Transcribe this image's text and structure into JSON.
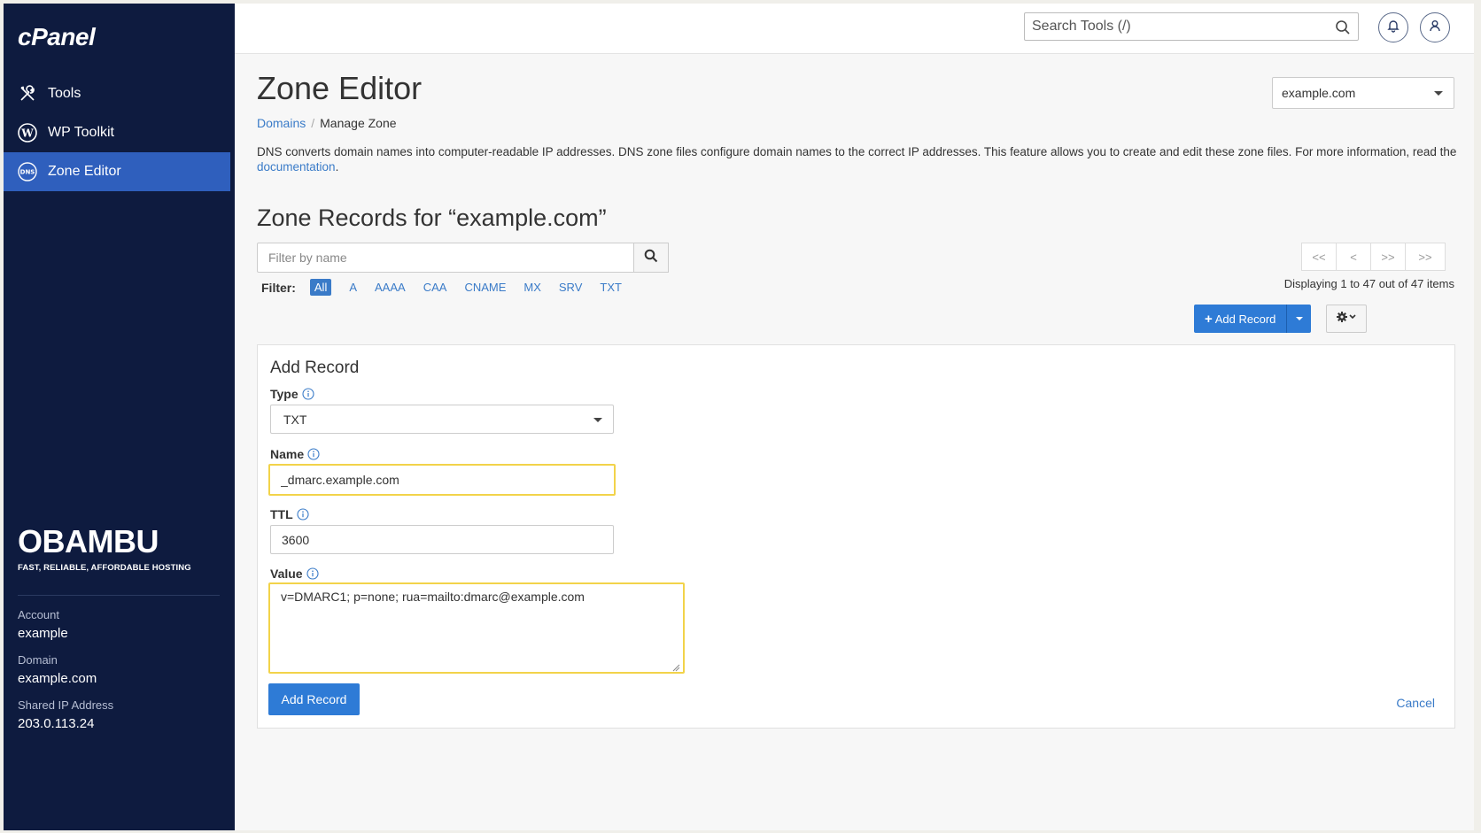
{
  "brand": "cPanel",
  "sidebar": {
    "items": [
      {
        "label": "Tools",
        "icon": "tools-icon"
      },
      {
        "label": "WP Toolkit",
        "icon": "wordpress-icon"
      },
      {
        "label": "Zone Editor",
        "icon": "dns-icon",
        "active": true
      }
    ],
    "hosting_logo": "OBAMBU",
    "hosting_tagline": "FAST, RELIABLE, AFFORDABLE HOSTING",
    "account_label": "Account",
    "account_value": "example",
    "domain_label": "Domain",
    "domain_value": "example.com",
    "ip_label": "Shared IP Address",
    "ip_value": "203.0.113.24"
  },
  "topbar": {
    "search_placeholder": "Search Tools (/)"
  },
  "main": {
    "title": "Zone Editor",
    "breadcrumb_link": "Domains",
    "breadcrumb_sep": "/",
    "breadcrumb_current": "Manage Zone",
    "domain_select": "example.com",
    "description": "DNS converts domain names into computer-readable IP addresses. DNS zone files configure domain names to the correct IP addresses. This feature allows you to create and edit these zone files. For more information, read the",
    "description_link": "documentation",
    "description_end": ".",
    "section_title": "Zone Records for “example.com”",
    "filter_placeholder": "Filter by name",
    "filter_label": "Filter:",
    "filters": [
      "All",
      "A",
      "AAAA",
      "CAA",
      "CNAME",
      "MX",
      "SRV",
      "TXT"
    ],
    "pager": [
      "<<",
      "<",
      ">>",
      ">>"
    ],
    "displaying": "Displaying 1 to 47 out of 47 items",
    "add_record_btn": "Add Record"
  },
  "form": {
    "title": "Add Record",
    "type_label": "Type",
    "type_value": "TXT",
    "name_label": "Name",
    "name_value": "_dmarc.example.com",
    "ttl_label": "TTL",
    "ttl_value": "3600",
    "value_label": "Value",
    "value_value": "v=DMARC1; p=none; rua=mailto:dmarc@example.com",
    "submit_label": "Add Record",
    "cancel_label": "Cancel"
  },
  "colors": {
    "sidebar_bg": "#0e1b3f",
    "sidebar_active": "#2f5fbd",
    "primary": "#2e7bd6",
    "highlight": "#f2d34a"
  }
}
